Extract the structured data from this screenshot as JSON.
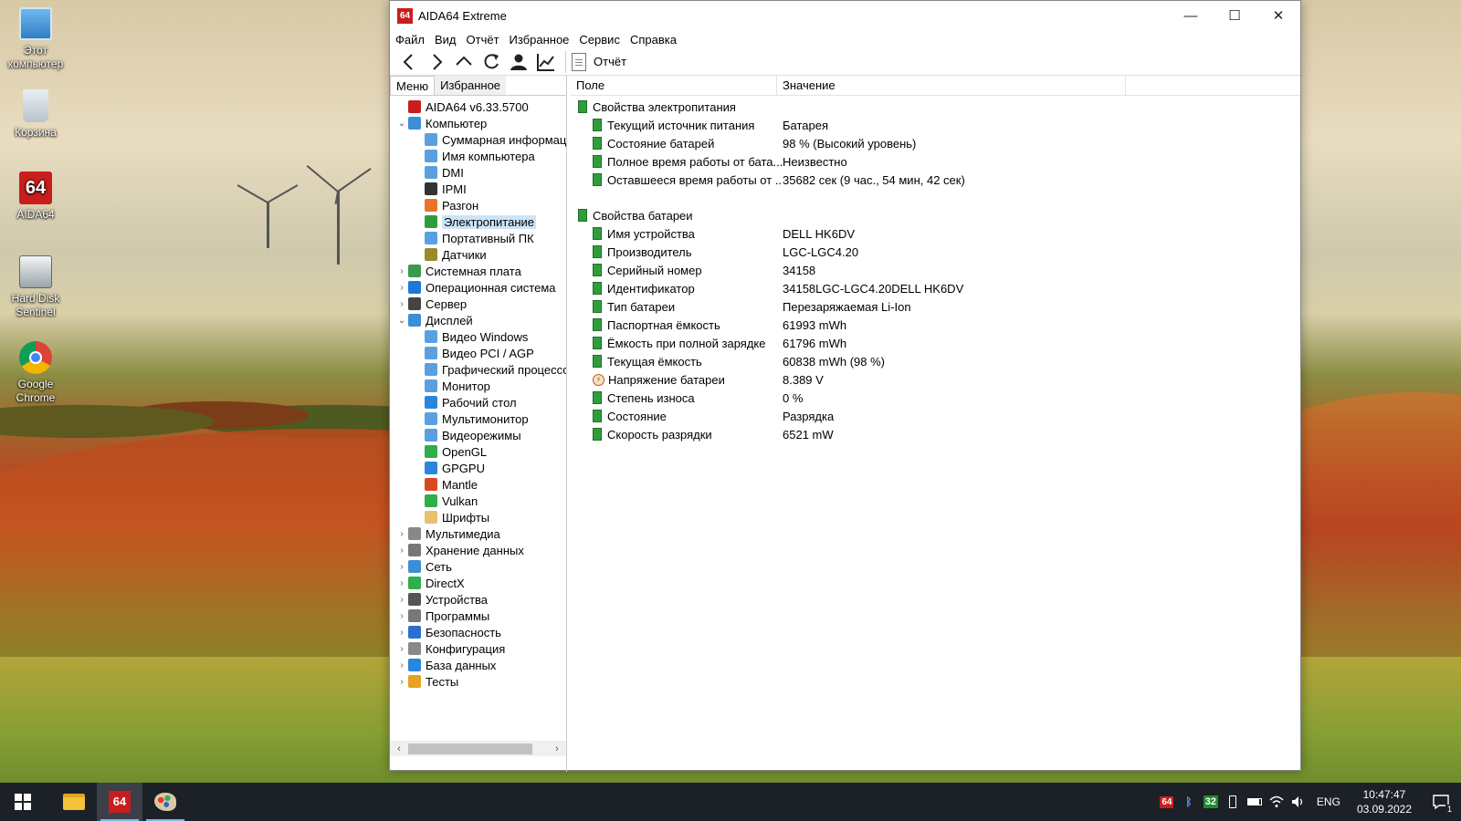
{
  "desktop": {
    "icons": [
      {
        "label": "Этот компьютер",
        "icon": "this-pc-icon"
      },
      {
        "label": "Корзина",
        "icon": "recycle-bin-icon"
      },
      {
        "label": "AIDA64",
        "icon": "aida64-icon"
      },
      {
        "label": "Hard Disk Sentinel",
        "icon": "hard-disk-sentinel-icon"
      },
      {
        "label": "Google Chrome",
        "icon": "chrome-icon"
      }
    ]
  },
  "window": {
    "logo_text": "64",
    "title": "AIDA64 Extreme",
    "controls": {
      "minimize": "—",
      "maximize": "☐",
      "close": "✕"
    },
    "menu": [
      "Файл",
      "Вид",
      "Отчёт",
      "Избранное",
      "Сервис",
      "Справка"
    ],
    "toolbar": {
      "report_label": "Отчёт"
    },
    "panel_tabs": [
      "Меню",
      "Избранное"
    ],
    "tree": [
      {
        "label": "AIDA64 v6.33.5700",
        "level": 0,
        "arrow": "",
        "color": "#c81e1e"
      },
      {
        "label": "Компьютер",
        "level": 0,
        "arrow": "⌄",
        "color": "#3b8fd6"
      },
      {
        "label": "Суммарная информация",
        "level": 1,
        "arrow": "",
        "color": "#5aa0e0"
      },
      {
        "label": "Имя компьютера",
        "level": 1,
        "arrow": "",
        "color": "#5aa0e0"
      },
      {
        "label": "DMI",
        "level": 1,
        "arrow": "",
        "color": "#5aa0e0"
      },
      {
        "label": "IPMI",
        "level": 1,
        "arrow": "",
        "color": "#333333"
      },
      {
        "label": "Разгон",
        "level": 1,
        "arrow": "",
        "color": "#e8742a"
      },
      {
        "label": "Электропитание",
        "level": 1,
        "arrow": "",
        "color": "#2f9e3a",
        "selected": true
      },
      {
        "label": "Портативный ПК",
        "level": 1,
        "arrow": "",
        "color": "#5aa0e0"
      },
      {
        "label": "Датчики",
        "level": 1,
        "arrow": "",
        "color": "#9a8a2a"
      },
      {
        "label": "Системная плата",
        "level": 0,
        "arrow": "›",
        "color": "#3a9a4a"
      },
      {
        "label": "Операционная система",
        "level": 0,
        "arrow": "›",
        "color": "#1e78d6"
      },
      {
        "label": "Сервер",
        "level": 0,
        "arrow": "›",
        "color": "#444444"
      },
      {
        "label": "Дисплей",
        "level": 0,
        "arrow": "⌄",
        "color": "#3b8fd6"
      },
      {
        "label": "Видео Windows",
        "level": 1,
        "arrow": "",
        "color": "#5aa0e0"
      },
      {
        "label": "Видео PCI / AGP",
        "level": 1,
        "arrow": "",
        "color": "#5aa0e0"
      },
      {
        "label": "Графический процессор",
        "level": 1,
        "arrow": "",
        "color": "#5aa0e0"
      },
      {
        "label": "Монитор",
        "level": 1,
        "arrow": "",
        "color": "#5aa0e0"
      },
      {
        "label": "Рабочий стол",
        "level": 1,
        "arrow": "",
        "color": "#2a86d8"
      },
      {
        "label": "Мультимонитор",
        "level": 1,
        "arrow": "",
        "color": "#5aa0e0"
      },
      {
        "label": "Видеорежимы",
        "level": 1,
        "arrow": "",
        "color": "#5aa0e0"
      },
      {
        "label": "OpenGL",
        "level": 1,
        "arrow": "",
        "color": "#2fae4a"
      },
      {
        "label": "GPGPU",
        "level": 1,
        "arrow": "",
        "color": "#2a86d8"
      },
      {
        "label": "Mantle",
        "level": 1,
        "arrow": "",
        "color": "#d84a1e"
      },
      {
        "label": "Vulkan",
        "level": 1,
        "arrow": "",
        "color": "#2fae4a"
      },
      {
        "label": "Шрифты",
        "level": 1,
        "arrow": "",
        "color": "#e8c070"
      },
      {
        "label": "Мультимедиа",
        "level": 0,
        "arrow": "›",
        "color": "#888888"
      },
      {
        "label": "Хранение данных",
        "level": 0,
        "arrow": "›",
        "color": "#777777"
      },
      {
        "label": "Сеть",
        "level": 0,
        "arrow": "›",
        "color": "#3b8fd6"
      },
      {
        "label": "DirectX",
        "level": 0,
        "arrow": "›",
        "color": "#2fae4a"
      },
      {
        "label": "Устройства",
        "level": 0,
        "arrow": "›",
        "color": "#555555"
      },
      {
        "label": "Программы",
        "level": 0,
        "arrow": "›",
        "color": "#777777"
      },
      {
        "label": "Безопасность",
        "level": 0,
        "arrow": "›",
        "color": "#2a6fd0"
      },
      {
        "label": "Конфигурация",
        "level": 0,
        "arrow": "›",
        "color": "#888888"
      },
      {
        "label": "База данных",
        "level": 0,
        "arrow": "›",
        "color": "#2a86d8"
      },
      {
        "label": "Тесты",
        "level": 0,
        "arrow": "›",
        "color": "#e8a020"
      }
    ],
    "columns": {
      "field": "Поле",
      "value": "Значение"
    },
    "sections": [
      {
        "title": "Свойства электропитания",
        "rows": [
          {
            "field": "Текущий источник питания",
            "value": "Батарея",
            "icon": "battery-icon"
          },
          {
            "field": "Состояние батарей",
            "value": "98 % (Высокий уровень)",
            "icon": "battery-icon"
          },
          {
            "field": "Полное время работы от бата...",
            "value": "Неизвестно",
            "icon": "battery-icon"
          },
          {
            "field": "Оставшееся время работы от ...",
            "value": "35682 сек (9 час., 54 мин, 42 сек)",
            "icon": "battery-icon"
          }
        ]
      },
      {
        "title": "Свойства батареи",
        "rows": [
          {
            "field": "Имя устройства",
            "value": "DELL HK6DV",
            "icon": "battery-icon"
          },
          {
            "field": "Производитель",
            "value": "LGC-LGC4.20",
            "icon": "battery-icon"
          },
          {
            "field": "Серийный номер",
            "value": "34158",
            "icon": "battery-icon"
          },
          {
            "field": "Идентификатор",
            "value": "34158LGC-LGC4.20DELL HK6DV",
            "icon": "battery-icon"
          },
          {
            "field": "Тип батареи",
            "value": "Перезаряжаемая Li-Ion",
            "icon": "battery-icon"
          },
          {
            "field": "Паспортная ёмкость",
            "value": "61993 mWh",
            "icon": "battery-icon"
          },
          {
            "field": "Ёмкость при полной зарядке",
            "value": "61796 mWh",
            "icon": "battery-icon"
          },
          {
            "field": "Текущая ёмкость",
            "value": "60838 mWh  (98 %)",
            "icon": "battery-icon"
          },
          {
            "field": "Напряжение батареи",
            "value": "8.389 V",
            "icon": "voltage-icon"
          },
          {
            "field": "Степень износа",
            "value": "0 %",
            "icon": "battery-icon"
          },
          {
            "field": "Состояние",
            "value": "Разрядка",
            "icon": "battery-icon"
          },
          {
            "field": "Скорость разрядки",
            "value": "6521 mW",
            "icon": "battery-icon"
          }
        ]
      }
    ]
  },
  "taskbar": {
    "aida_label": "64",
    "tray_badge": "32",
    "language": "ENG",
    "time": "10:47:47",
    "date": "03.09.2022",
    "notification_count": "1"
  }
}
